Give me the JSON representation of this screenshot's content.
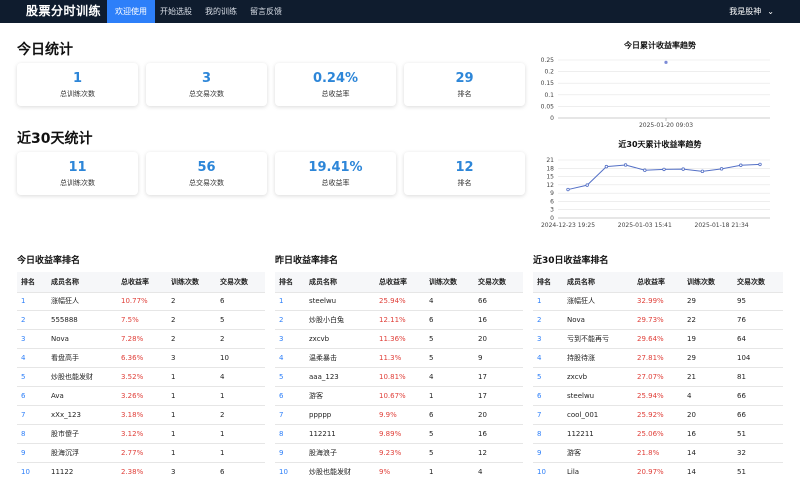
{
  "nav": {
    "brand": "股票分时训练",
    "items": [
      "欢迎使用",
      "开始选股",
      "我的训练",
      "留言反馈"
    ],
    "user": "我是股神"
  },
  "today": {
    "title": "今日统计",
    "cards": [
      {
        "value": "1",
        "label": "总训练次数"
      },
      {
        "value": "3",
        "label": "总交易次数"
      },
      {
        "value": "0.24%",
        "label": "总收益率"
      },
      {
        "value": "29",
        "label": "排名"
      }
    ]
  },
  "month": {
    "title": "近30天统计",
    "cards": [
      {
        "value": "11",
        "label": "总训练次数"
      },
      {
        "value": "56",
        "label": "总交易次数"
      },
      {
        "value": "19.41%",
        "label": "总收益率"
      },
      {
        "value": "12",
        "label": "排名"
      }
    ]
  },
  "colors": {
    "accent": "#2d7ff9",
    "value": "#2d86d8",
    "gain": "#e0403a",
    "nav_bg": "#0f1c2e",
    "line": "#5470c6"
  },
  "chart_data": [
    {
      "type": "scatter",
      "title": "今日累计收益率趋势",
      "yticks": [
        "0",
        "0.05",
        "0.1",
        "0.15",
        "0.2",
        "0.25"
      ],
      "ylim": [
        0,
        0.25
      ],
      "xlabel_tick": "2025-01-20 09:03",
      "points": [
        {
          "x": "2025-01-20 09:03",
          "y": 0.24
        }
      ]
    },
    {
      "type": "line",
      "title": "近30天累计收益率趋势",
      "yticks": [
        "0",
        "3",
        "6",
        "9",
        "12",
        "15",
        "18",
        "21"
      ],
      "ylim": [
        0,
        21
      ],
      "xticks": [
        "2024-12-23 19:25",
        "2025-01-03 15:41",
        "2025-01-18 21:34"
      ],
      "values": [
        10.3,
        11.9,
        18.6,
        19.2,
        17.3,
        17.6,
        17.7,
        16.9,
        17.8,
        19.1,
        19.4
      ]
    }
  ],
  "rankings": [
    {
      "title": "今日收益率排名",
      "headers": [
        "排名",
        "成员名称",
        "总收益率",
        "训练次数",
        "交易次数"
      ],
      "rows": [
        [
          "1",
          "涨幅狂人",
          "10.77%",
          "2",
          "6"
        ],
        [
          "2",
          "555888",
          "7.5%",
          "2",
          "5"
        ],
        [
          "3",
          "Nova",
          "7.28%",
          "2",
          "2"
        ],
        [
          "4",
          "看盘高手",
          "6.36%",
          "3",
          "10"
        ],
        [
          "5",
          "炒股也能发财",
          "3.52%",
          "1",
          "4"
        ],
        [
          "6",
          "Ava",
          "3.26%",
          "1",
          "1"
        ],
        [
          "7",
          "xXx_123",
          "3.18%",
          "1",
          "2"
        ],
        [
          "8",
          "股市傻子",
          "3.12%",
          "1",
          "1"
        ],
        [
          "9",
          "股海沉浮",
          "2.77%",
          "1",
          "1"
        ],
        [
          "10",
          "11122",
          "2.38%",
          "3",
          "6"
        ]
      ]
    },
    {
      "title": "昨日收益率排名",
      "headers": [
        "排名",
        "成员名称",
        "总收益率",
        "训练次数",
        "交易次数"
      ],
      "rows": [
        [
          "1",
          "steelwu",
          "25.94%",
          "4",
          "66"
        ],
        [
          "2",
          "炒股小白兔",
          "12.11%",
          "6",
          "16"
        ],
        [
          "3",
          "zxcvb",
          "11.36%",
          "5",
          "20"
        ],
        [
          "4",
          "温柔暴击",
          "11.3%",
          "5",
          "9"
        ],
        [
          "5",
          "aaa_123",
          "10.81%",
          "4",
          "17"
        ],
        [
          "6",
          "游客",
          "10.67%",
          "1",
          "17"
        ],
        [
          "7",
          "ppppp",
          "9.9%",
          "6",
          "20"
        ],
        [
          "8",
          "112211",
          "9.89%",
          "5",
          "16"
        ],
        [
          "9",
          "股海浪子",
          "9.23%",
          "5",
          "12"
        ],
        [
          "10",
          "炒股也能发财",
          "9%",
          "1",
          "4"
        ]
      ]
    },
    {
      "title": "近30日收益率排名",
      "headers": [
        "排名",
        "成员名称",
        "总收益率",
        "训练次数",
        "交易次数"
      ],
      "rows": [
        [
          "1",
          "涨幅狂人",
          "32.99%",
          "29",
          "95"
        ],
        [
          "2",
          "Nova",
          "29.73%",
          "22",
          "76"
        ],
        [
          "3",
          "亏到不能再亏",
          "29.64%",
          "19",
          "64"
        ],
        [
          "4",
          "持股待涨",
          "27.81%",
          "29",
          "104"
        ],
        [
          "5",
          "zxcvb",
          "27.07%",
          "21",
          "81"
        ],
        [
          "6",
          "steelwu",
          "25.94%",
          "4",
          "66"
        ],
        [
          "7",
          "cool_001",
          "25.92%",
          "20",
          "66"
        ],
        [
          "8",
          "112211",
          "25.06%",
          "16",
          "51"
        ],
        [
          "9",
          "游客",
          "21.8%",
          "14",
          "32"
        ],
        [
          "10",
          "Lila",
          "20.97%",
          "14",
          "51"
        ]
      ]
    }
  ]
}
